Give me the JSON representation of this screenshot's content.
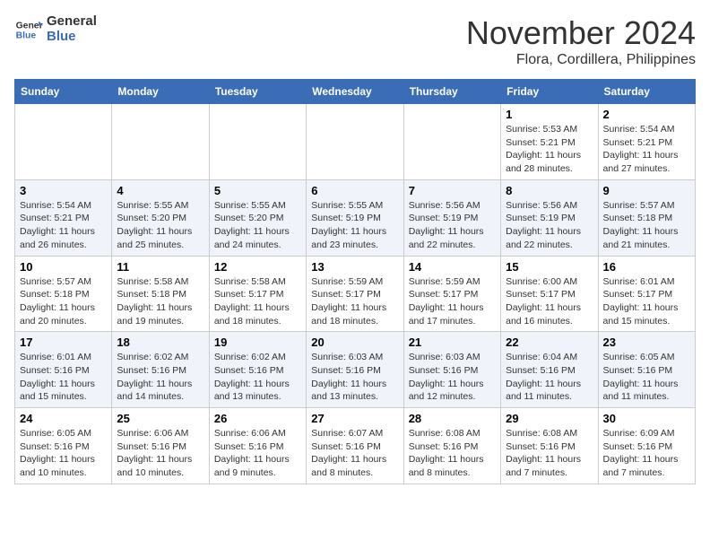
{
  "header": {
    "logo_line1": "General",
    "logo_line2": "Blue",
    "month": "November 2024",
    "location": "Flora, Cordillera, Philippines"
  },
  "calendar": {
    "days_of_week": [
      "Sunday",
      "Monday",
      "Tuesday",
      "Wednesday",
      "Thursday",
      "Friday",
      "Saturday"
    ],
    "weeks": [
      [
        {
          "day": "",
          "info": ""
        },
        {
          "day": "",
          "info": ""
        },
        {
          "day": "",
          "info": ""
        },
        {
          "day": "",
          "info": ""
        },
        {
          "day": "",
          "info": ""
        },
        {
          "day": "1",
          "info": "Sunrise: 5:53 AM\nSunset: 5:21 PM\nDaylight: 11 hours\nand 28 minutes."
        },
        {
          "day": "2",
          "info": "Sunrise: 5:54 AM\nSunset: 5:21 PM\nDaylight: 11 hours\nand 27 minutes."
        }
      ],
      [
        {
          "day": "3",
          "info": "Sunrise: 5:54 AM\nSunset: 5:21 PM\nDaylight: 11 hours\nand 26 minutes."
        },
        {
          "day": "4",
          "info": "Sunrise: 5:55 AM\nSunset: 5:20 PM\nDaylight: 11 hours\nand 25 minutes."
        },
        {
          "day": "5",
          "info": "Sunrise: 5:55 AM\nSunset: 5:20 PM\nDaylight: 11 hours\nand 24 minutes."
        },
        {
          "day": "6",
          "info": "Sunrise: 5:55 AM\nSunset: 5:19 PM\nDaylight: 11 hours\nand 23 minutes."
        },
        {
          "day": "7",
          "info": "Sunrise: 5:56 AM\nSunset: 5:19 PM\nDaylight: 11 hours\nand 22 minutes."
        },
        {
          "day": "8",
          "info": "Sunrise: 5:56 AM\nSunset: 5:19 PM\nDaylight: 11 hours\nand 22 minutes."
        },
        {
          "day": "9",
          "info": "Sunrise: 5:57 AM\nSunset: 5:18 PM\nDaylight: 11 hours\nand 21 minutes."
        }
      ],
      [
        {
          "day": "10",
          "info": "Sunrise: 5:57 AM\nSunset: 5:18 PM\nDaylight: 11 hours\nand 20 minutes."
        },
        {
          "day": "11",
          "info": "Sunrise: 5:58 AM\nSunset: 5:18 PM\nDaylight: 11 hours\nand 19 minutes."
        },
        {
          "day": "12",
          "info": "Sunrise: 5:58 AM\nSunset: 5:17 PM\nDaylight: 11 hours\nand 18 minutes."
        },
        {
          "day": "13",
          "info": "Sunrise: 5:59 AM\nSunset: 5:17 PM\nDaylight: 11 hours\nand 18 minutes."
        },
        {
          "day": "14",
          "info": "Sunrise: 5:59 AM\nSunset: 5:17 PM\nDaylight: 11 hours\nand 17 minutes."
        },
        {
          "day": "15",
          "info": "Sunrise: 6:00 AM\nSunset: 5:17 PM\nDaylight: 11 hours\nand 16 minutes."
        },
        {
          "day": "16",
          "info": "Sunrise: 6:01 AM\nSunset: 5:17 PM\nDaylight: 11 hours\nand 15 minutes."
        }
      ],
      [
        {
          "day": "17",
          "info": "Sunrise: 6:01 AM\nSunset: 5:16 PM\nDaylight: 11 hours\nand 15 minutes."
        },
        {
          "day": "18",
          "info": "Sunrise: 6:02 AM\nSunset: 5:16 PM\nDaylight: 11 hours\nand 14 minutes."
        },
        {
          "day": "19",
          "info": "Sunrise: 6:02 AM\nSunset: 5:16 PM\nDaylight: 11 hours\nand 13 minutes."
        },
        {
          "day": "20",
          "info": "Sunrise: 6:03 AM\nSunset: 5:16 PM\nDaylight: 11 hours\nand 13 minutes."
        },
        {
          "day": "21",
          "info": "Sunrise: 6:03 AM\nSunset: 5:16 PM\nDaylight: 11 hours\nand 12 minutes."
        },
        {
          "day": "22",
          "info": "Sunrise: 6:04 AM\nSunset: 5:16 PM\nDaylight: 11 hours\nand 11 minutes."
        },
        {
          "day": "23",
          "info": "Sunrise: 6:05 AM\nSunset: 5:16 PM\nDaylight: 11 hours\nand 11 minutes."
        }
      ],
      [
        {
          "day": "24",
          "info": "Sunrise: 6:05 AM\nSunset: 5:16 PM\nDaylight: 11 hours\nand 10 minutes."
        },
        {
          "day": "25",
          "info": "Sunrise: 6:06 AM\nSunset: 5:16 PM\nDaylight: 11 hours\nand 10 minutes."
        },
        {
          "day": "26",
          "info": "Sunrise: 6:06 AM\nSunset: 5:16 PM\nDaylight: 11 hours\nand 9 minutes."
        },
        {
          "day": "27",
          "info": "Sunrise: 6:07 AM\nSunset: 5:16 PM\nDaylight: 11 hours\nand 8 minutes."
        },
        {
          "day": "28",
          "info": "Sunrise: 6:08 AM\nSunset: 5:16 PM\nDaylight: 11 hours\nand 8 minutes."
        },
        {
          "day": "29",
          "info": "Sunrise: 6:08 AM\nSunset: 5:16 PM\nDaylight: 11 hours\nand 7 minutes."
        },
        {
          "day": "30",
          "info": "Sunrise: 6:09 AM\nSunset: 5:16 PM\nDaylight: 11 hours\nand 7 minutes."
        }
      ]
    ]
  }
}
